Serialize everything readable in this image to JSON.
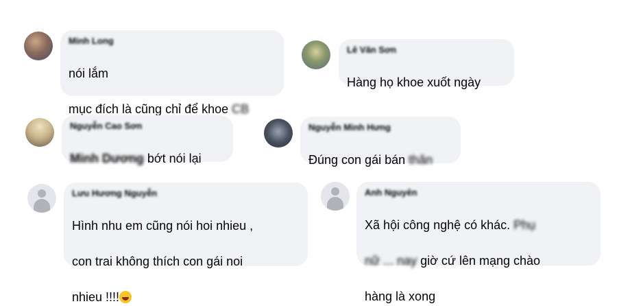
{
  "comments": [
    {
      "name": "Minh Long",
      "line1": "nói lắm",
      "line2_prefix": "mục đích là cũng chỉ để khoe ",
      "line2_blur": "CB"
    },
    {
      "name": "Lê Văn Sơn",
      "line1": "Hàng họ khoe xuốt ngày"
    },
    {
      "name": "Nguyễn Cao Sơn",
      "mention": "Minh Dương",
      "text_suffix": " bớt nói lại"
    },
    {
      "name": "Nguyễn Minh Hưng",
      "text_prefix": "Đúng con gái bán ",
      "text_blur": "thân"
    },
    {
      "name": "Lưu Hương Nguyễn",
      "line1": "Hình nhu em cũng nói hoi nhieu ,",
      "line2": "con trai không thích con gái noi",
      "line3": "nhieu !!!!"
    },
    {
      "name": "Anh Nguyên",
      "line1_prefix": "Xã hội công nghệ có khác. ",
      "line1_blur": "Phụ",
      "line2_blur": "nữ ... nay",
      "line2_suffix": " giờ cứ lên mạng chào",
      "line3": "hàng là xong"
    }
  ],
  "icons": {
    "emoji": "laughing-emoji"
  }
}
